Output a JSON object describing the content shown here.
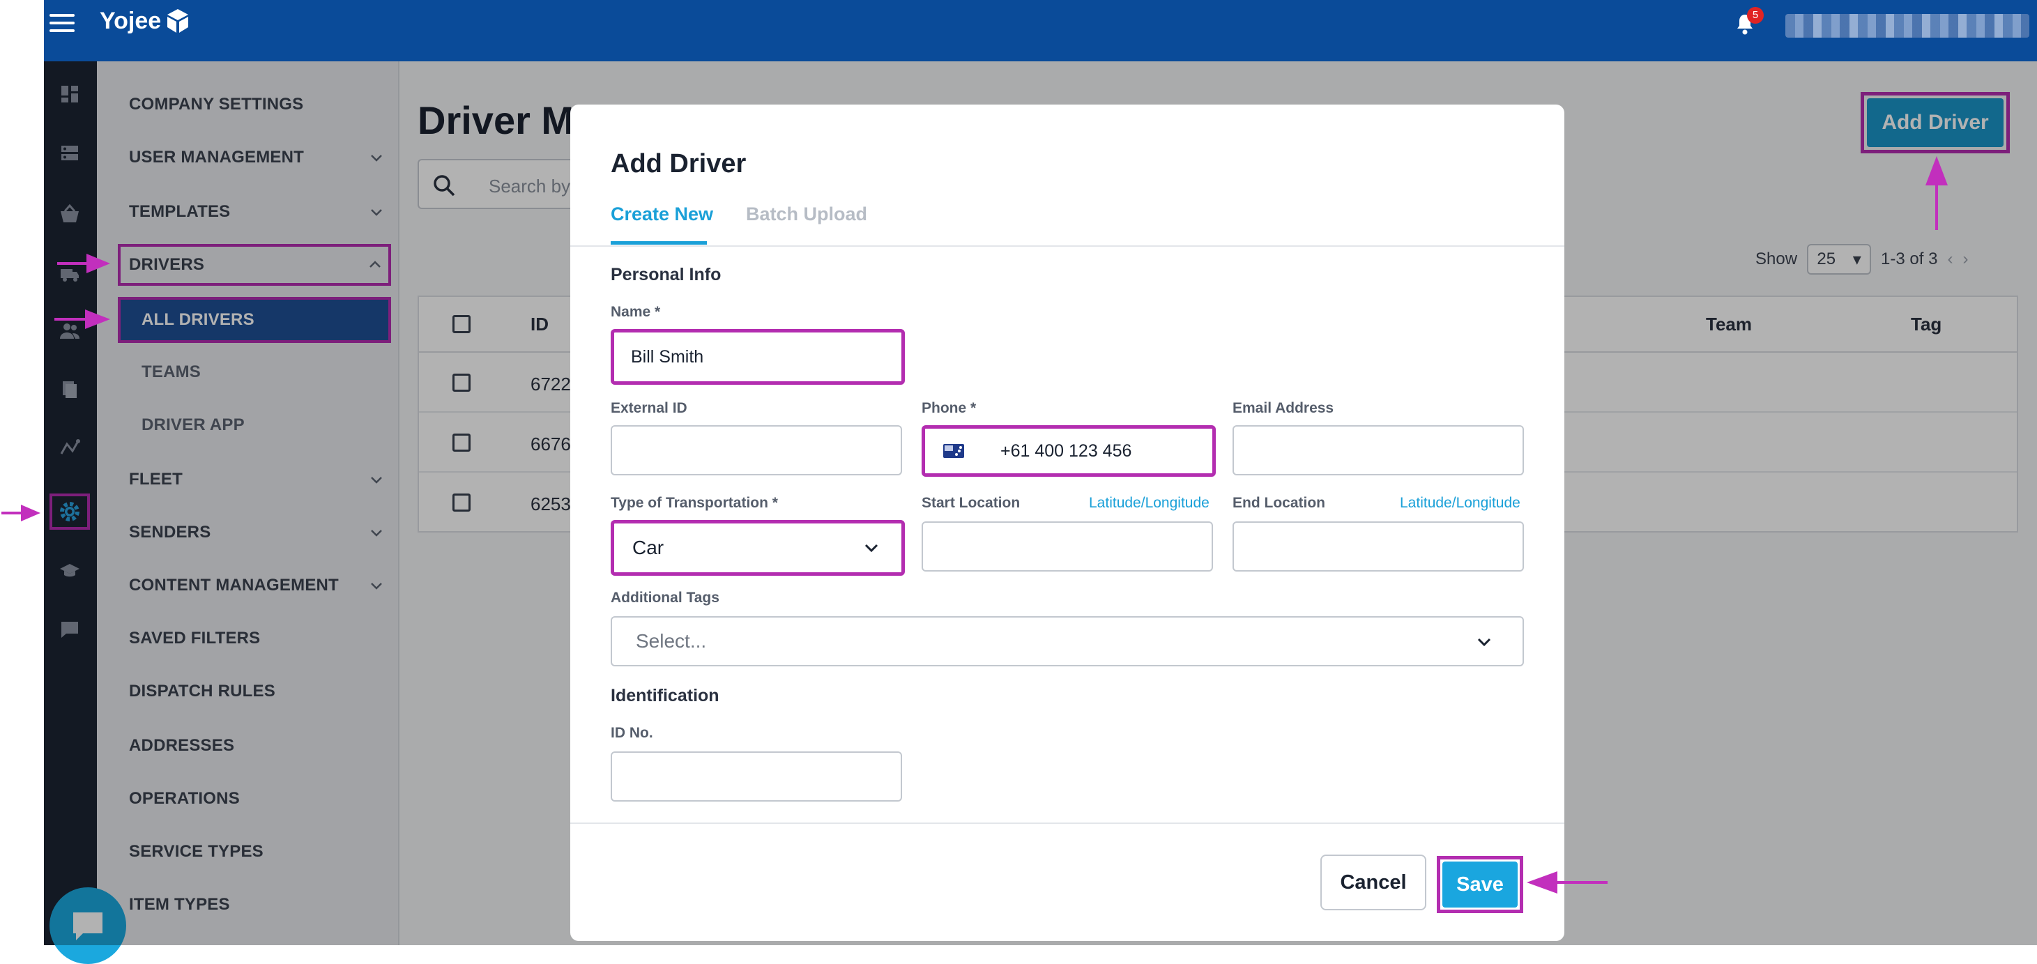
{
  "header": {
    "logo_text": "Yojee",
    "notification_count": "5"
  },
  "sidebar": {
    "items": [
      {
        "label": "COMPANY SETTINGS"
      },
      {
        "label": "USER MANAGEMENT"
      },
      {
        "label": "TEMPLATES"
      },
      {
        "label": "DRIVERS"
      },
      {
        "label": "ALL DRIVERS"
      },
      {
        "label": "TEAMS"
      },
      {
        "label": "DRIVER APP"
      },
      {
        "label": "FLEET"
      },
      {
        "label": "SENDERS"
      },
      {
        "label": "CONTENT MANAGEMENT"
      },
      {
        "label": "SAVED FILTERS"
      },
      {
        "label": "DISPATCH RULES"
      },
      {
        "label": "ADDRESSES"
      },
      {
        "label": "OPERATIONS"
      },
      {
        "label": "SERVICE TYPES"
      },
      {
        "label": "ITEM TYPES"
      }
    ]
  },
  "main": {
    "title": "Driver M",
    "search_placeholder": "Search by",
    "add_driver_label": "Add Driver",
    "pager": {
      "show_label": "Show",
      "page_size": "25",
      "range": "1-3 of 3"
    },
    "table": {
      "columns": [
        "ID",
        "Team",
        "Tag"
      ],
      "rows": [
        {
          "id": "6722"
        },
        {
          "id": "6676"
        },
        {
          "id": "6253"
        }
      ]
    }
  },
  "modal": {
    "title": "Add Driver",
    "tabs": [
      "Create New",
      "Batch Upload"
    ],
    "personal_info_label": "Personal Info",
    "name": {
      "label": "Name *",
      "value": "Bill Smith"
    },
    "external_id": {
      "label": "External ID",
      "value": ""
    },
    "phone": {
      "label": "Phone *",
      "value": "+61 400 123 456",
      "country": "Australia"
    },
    "email": {
      "label": "Email Address",
      "value": ""
    },
    "transport": {
      "label": "Type of Transportation *",
      "value": "Car"
    },
    "start_location": {
      "label": "Start Location",
      "link": "Latitude/Longitude",
      "value": ""
    },
    "end_location": {
      "label": "End Location",
      "link": "Latitude/Longitude",
      "value": ""
    },
    "tags": {
      "label": "Additional Tags",
      "placeholder": "Select..."
    },
    "identification_label": "Identification",
    "id_no": {
      "label": "ID No.",
      "value": ""
    },
    "cancel_label": "Cancel",
    "save_label": "Save"
  },
  "colors": {
    "topbar": "#0a4b99",
    "rail": "#1c2433",
    "accent": "#1aa0d8",
    "highlight": "#b32db0",
    "sidebar_active": "#1f4f95"
  }
}
